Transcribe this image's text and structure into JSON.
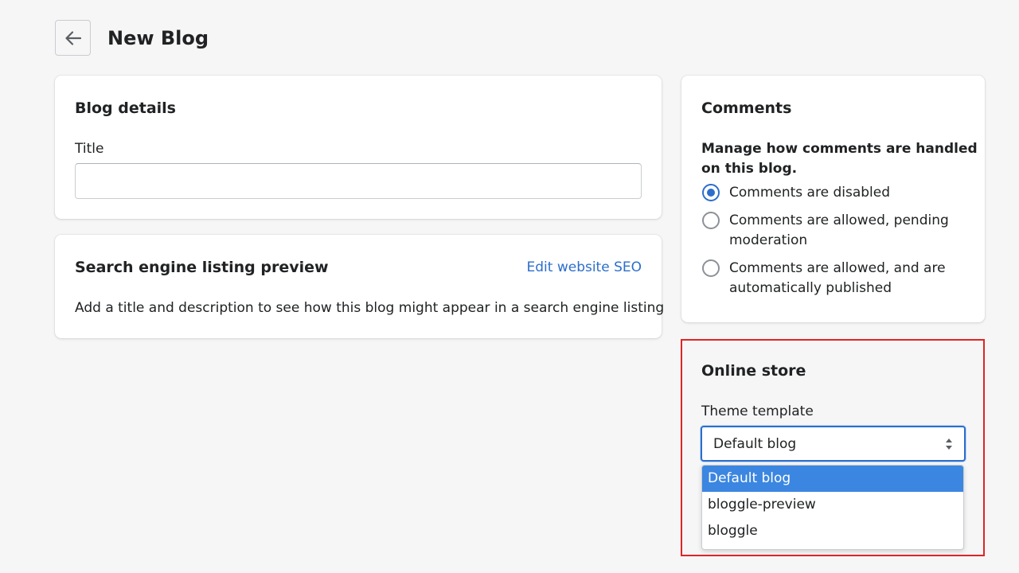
{
  "header": {
    "title": "New Blog"
  },
  "blog_details": {
    "heading": "Blog details",
    "title_label": "Title",
    "title_value": "",
    "title_placeholder": ""
  },
  "seo": {
    "heading": "Search engine listing preview",
    "edit_link": "Edit website SEO",
    "description": "Add a title and description to see how this blog might appear in a search engine listing"
  },
  "comments": {
    "heading": "Comments",
    "intro_line1": "Manage how comments are handled",
    "intro_line2": "on this blog.",
    "options": [
      {
        "line1": "Comments are disabled",
        "line2": "",
        "checked": true
      },
      {
        "line1": "Comments are allowed, pending",
        "line2": "moderation",
        "checked": false
      },
      {
        "line1": "Comments are allowed, and are",
        "line2": "automatically published",
        "checked": false
      }
    ]
  },
  "online_store": {
    "heading": "Online store",
    "template_label": "Theme template",
    "selected_template": "Default blog",
    "template_options": [
      "Default blog",
      "bloggle-preview",
      "bloggle"
    ]
  },
  "colors": {
    "accent": "#2c6ecb",
    "option_highlight": "#3b86e0",
    "annotation_border": "#e02424",
    "background": "#f6f6f7"
  }
}
